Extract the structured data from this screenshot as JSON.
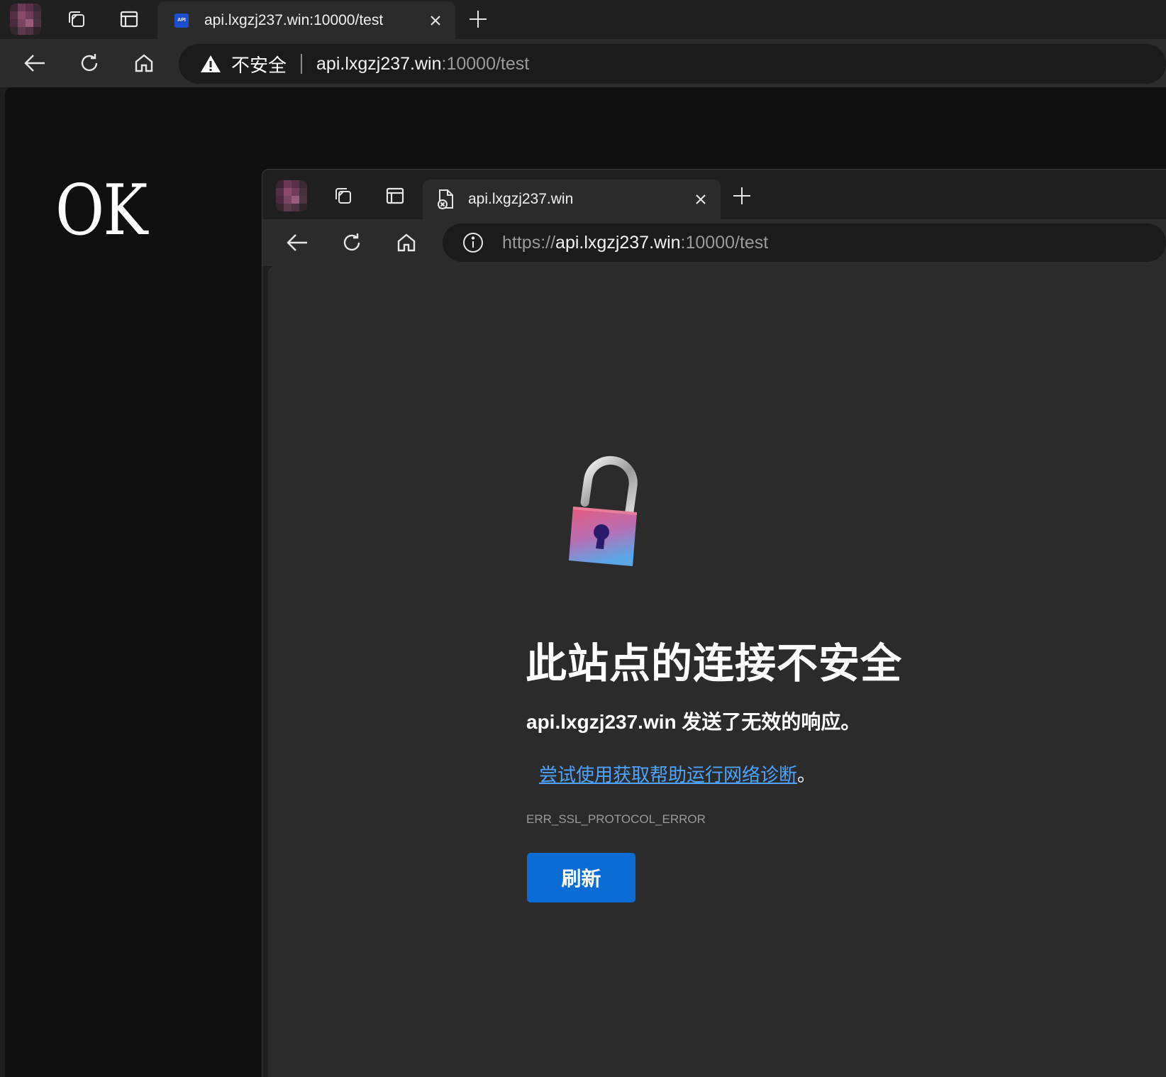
{
  "outer_browser": {
    "tab": {
      "title": "api.lxgzj237.win:10000/test",
      "favicon_label": "API",
      "close_icon": "close-icon"
    },
    "address_bar": {
      "security_label": "不安全",
      "url_host": "api.lxgzj237.win",
      "url_rest": ":10000/test"
    },
    "page": {
      "text": "OK"
    }
  },
  "inner_browser": {
    "tab": {
      "title": "api.lxgzj237.win"
    },
    "address_bar": {
      "url_scheme": "https://",
      "url_host": "api.lxgzj237.win",
      "url_rest": ":10000/test"
    },
    "error_page": {
      "title": "此站点的连接不安全",
      "description": "api.lxgzj237.win 发送了无效的响应。",
      "link_text": "尝试使用获取帮助运行网络诊断",
      "link_suffix": "。",
      "error_code": "ERR_SSL_PROTOCOL_ERROR",
      "refresh_label": "刷新"
    }
  },
  "colors": {
    "accent": "#0b6cd6",
    "link": "#4da3ff",
    "background": "#2b2b2b"
  }
}
